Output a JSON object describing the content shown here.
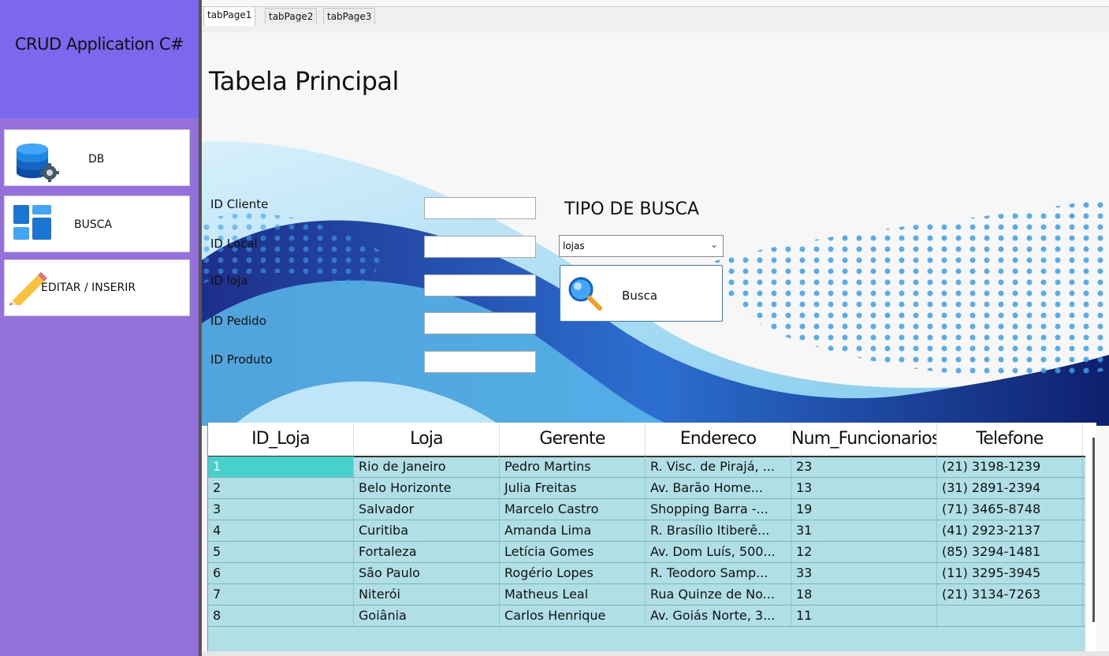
{
  "sidebar": {
    "app_title": "CRUD  Application C#",
    "buttons": [
      {
        "label": "DB",
        "icon": "database-gear-icon"
      },
      {
        "label": "BUSCA",
        "icon": "dashboard-icon"
      },
      {
        "label": "EDITAR / INSERIR",
        "icon": "pencil-icon"
      }
    ]
  },
  "tabs": [
    "tabPage1",
    "tabPage2",
    "tabPage3"
  ],
  "main": {
    "title": "Tabela Principal",
    "fields": [
      {
        "label": "ID Cliente",
        "value": ""
      },
      {
        "label": "ID Local",
        "value": ""
      },
      {
        "label": "ID loja",
        "value": ""
      },
      {
        "label": "ID Pedido",
        "value": ""
      },
      {
        "label": "ID Produto",
        "value": ""
      }
    ],
    "tipo_label": "TIPO DE BUSCA",
    "tipo_selected": "lojas",
    "busca_label": "Busca"
  },
  "grid": {
    "columns": [
      "ID_Loja",
      "Loja",
      "Gerente",
      "Endereco",
      "Num_Funcionarios",
      "Telefone"
    ],
    "rows": [
      [
        "1",
        "Rio de Janeiro",
        "Pedro Martins",
        "R. Visc. de Pirajá, ...",
        "23",
        "(21) 3198-1239"
      ],
      [
        "2",
        "Belo Horizonte",
        "Julia Freitas",
        "Av. Barão Home...",
        "13",
        "(31) 2891-2394"
      ],
      [
        "3",
        "Salvador",
        "Marcelo Castro",
        "Shopping Barra -...",
        "19",
        "(71) 3465-8748"
      ],
      [
        "4",
        "Curitiba",
        "Amanda Lima",
        "R. Brasílio Itiberê...",
        "31",
        "(41) 2923-2137"
      ],
      [
        "5",
        "Fortaleza",
        "Letícia Gomes",
        "Av. Dom Luís, 500...",
        "12",
        "(85) 3294-1481"
      ],
      [
        "6",
        "São Paulo",
        "Rogério Lopes",
        "R. Teodoro Samp...",
        "33",
        "(11) 3295-3945"
      ],
      [
        "7",
        "Niterói",
        "Matheus Leal",
        "Rua Quinze de No...",
        "18",
        "(21) 3134-7263"
      ],
      [
        "8",
        "Goiânia",
        "Carlos Henrique",
        "Av. Goiás Norte, 3...",
        "11",
        ""
      ]
    ],
    "selected_row": 0
  },
  "colors": {
    "sidebar": "#9370db",
    "sidebar_header": "#7b68ee",
    "grid_bg": "#b0e0e6",
    "selected_cell": "#48d1cc",
    "accent_border": "#2f7cd6"
  }
}
